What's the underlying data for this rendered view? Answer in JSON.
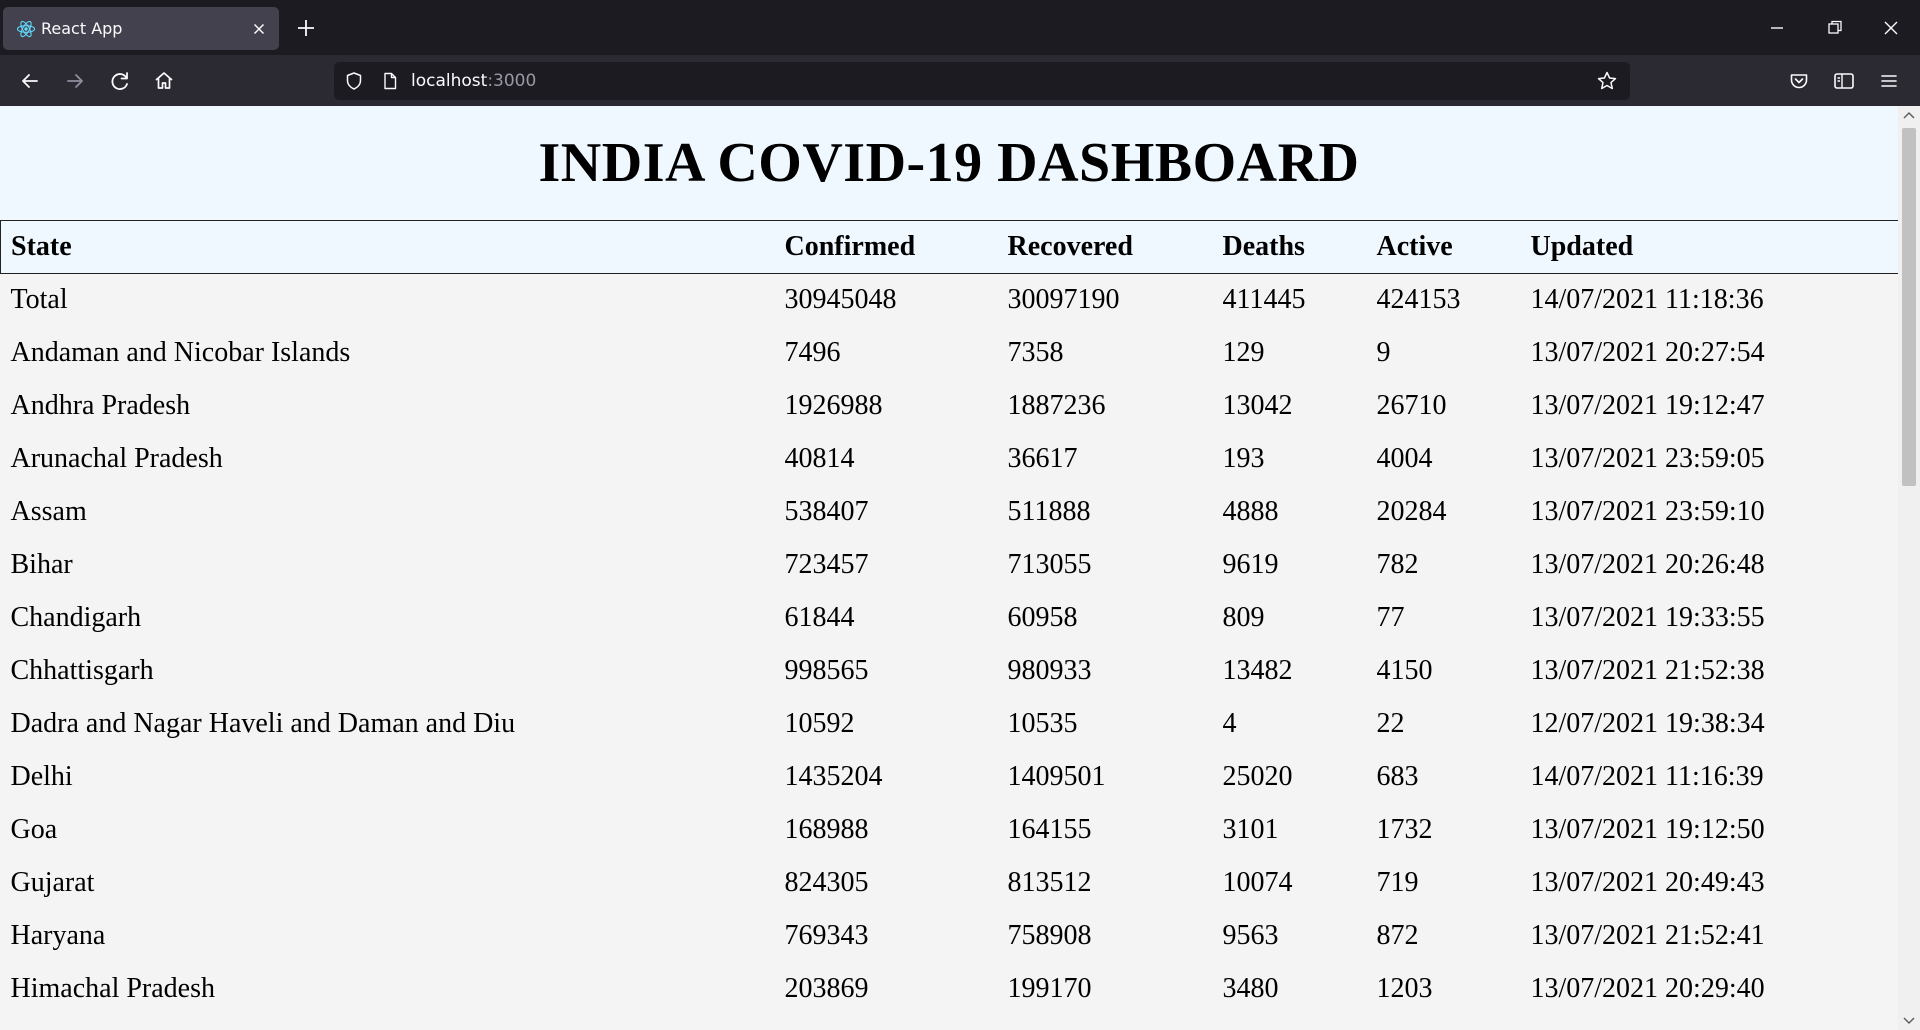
{
  "browser": {
    "tab_title": "React App",
    "url_host": "localhost",
    "url_port": ":3000",
    "icons": {
      "favicon": "react-logo-icon",
      "tab_close": "close-icon",
      "new_tab": "plus-icon",
      "minimize": "minimize-icon",
      "restore": "restore-icon",
      "close": "close-icon",
      "back": "arrow-left-icon",
      "forward": "arrow-right-icon",
      "reload": "reload-icon",
      "home": "home-icon",
      "tracking": "shield-icon",
      "page": "page-icon",
      "bookmark": "star-icon",
      "pocket": "pocket-icon",
      "sidebar": "sidebar-icon",
      "menu": "hamburger-menu-icon"
    }
  },
  "page": {
    "title": "INDIA COVID-19 DASHBOARD",
    "header_bg": "#f0f8ff",
    "table": {
      "headers": [
        "State",
        "Confirmed",
        "Recovered",
        "Deaths",
        "Active",
        "Updated"
      ],
      "rows": [
        [
          "Total",
          "30945048",
          "30097190",
          "411445",
          "424153",
          "14/07/2021 11:18:36"
        ],
        [
          "Andaman and Nicobar Islands",
          "7496",
          "7358",
          "129",
          "9",
          "13/07/2021 20:27:54"
        ],
        [
          "Andhra Pradesh",
          "1926988",
          "1887236",
          "13042",
          "26710",
          "13/07/2021 19:12:47"
        ],
        [
          "Arunachal Pradesh",
          "40814",
          "36617",
          "193",
          "4004",
          "13/07/2021 23:59:05"
        ],
        [
          "Assam",
          "538407",
          "511888",
          "4888",
          "20284",
          "13/07/2021 23:59:10"
        ],
        [
          "Bihar",
          "723457",
          "713055",
          "9619",
          "782",
          "13/07/2021 20:26:48"
        ],
        [
          "Chandigarh",
          "61844",
          "60958",
          "809",
          "77",
          "13/07/2021 19:33:55"
        ],
        [
          "Chhattisgarh",
          "998565",
          "980933",
          "13482",
          "4150",
          "13/07/2021 21:52:38"
        ],
        [
          "Dadra and Nagar Haveli and Daman and Diu",
          "10592",
          "10535",
          "4",
          "22",
          "12/07/2021 19:38:34"
        ],
        [
          "Delhi",
          "1435204",
          "1409501",
          "25020",
          "683",
          "14/07/2021 11:16:39"
        ],
        [
          "Goa",
          "168988",
          "164155",
          "3101",
          "1732",
          "13/07/2021 19:12:50"
        ],
        [
          "Gujarat",
          "824305",
          "813512",
          "10074",
          "719",
          "13/07/2021 20:49:43"
        ],
        [
          "Haryana",
          "769343",
          "758908",
          "9563",
          "872",
          "13/07/2021 21:52:41"
        ],
        [
          "Himachal Pradesh",
          "203869",
          "199170",
          "3480",
          "1203",
          "13/07/2021 20:29:40"
        ]
      ]
    }
  }
}
